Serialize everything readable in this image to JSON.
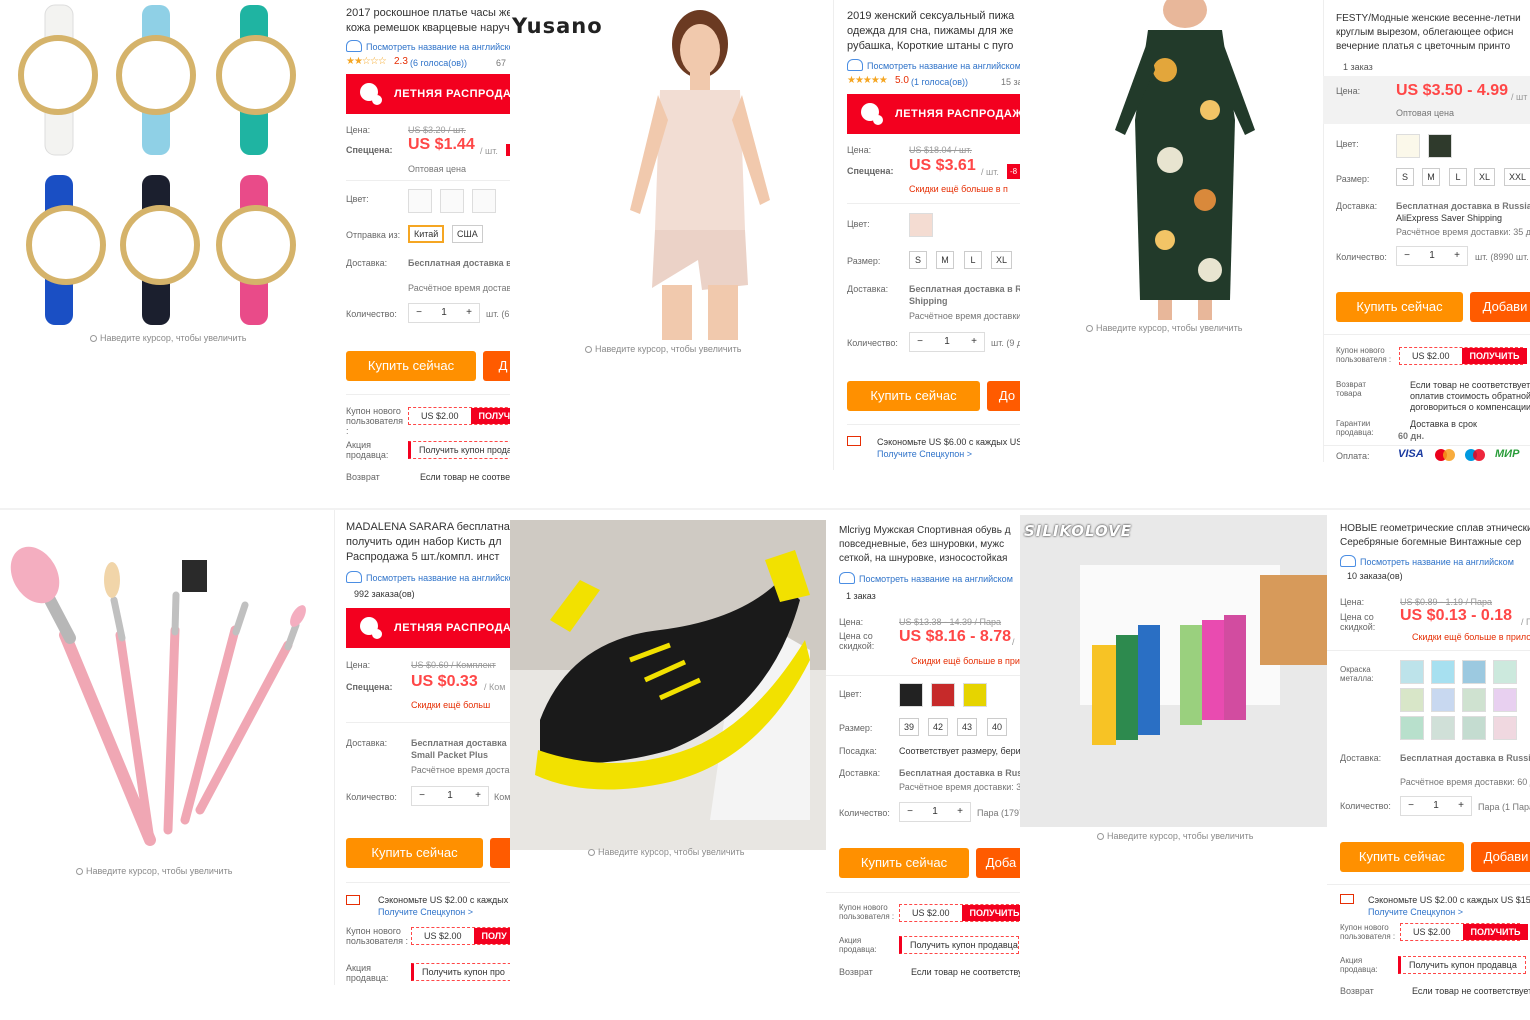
{
  "common": {
    "hover_hint": "Наведите курсор, чтобы увеличить",
    "price_label": "Цена:",
    "special_label": "Спеццена:",
    "price_disc_label": "Цена со скидкой:",
    "color_label": "Цвет:",
    "size_label": "Размер:",
    "delivery_label": "Доставка:",
    "quantity_label": "Количество:",
    "ship_from_label": "Отправка из:",
    "buy_now": "Купить сейчас",
    "add_cart_cut": "Д",
    "add_cart_full": "Добави",
    "add_cart_mid": "Доба",
    "coupon_label": "Купон нового пользователя :",
    "seller_promo_label": "Акция продавца:",
    "return_label": "Возврат",
    "return_goods_label": "Возврат товара",
    "guarantee_label": "Гарантии продавца:",
    "payment_label": "Оплата:",
    "summer_sale": "ЛЕТНЯЯ РАСПРОДАЖА",
    "translate_link": "Посмотреть название на английском",
    "wholesale": "Оптовая цена",
    "free_shipping_to": "Бесплатная доставка в",
    "estimated_time": "Расчётное время доставки:",
    "coupon_value": "US $2.00",
    "get": "ПОЛУЧИТЬ",
    "get_seller_coupon": "Получить купон продавца",
    "if_not_match": "Если товар не соответствует",
    "discount_more": "Скидки ещё больше в приложении",
    "get_special_coupon": "Получите Спецкупон >",
    "minus": "−",
    "plus": "+",
    "one": "1"
  },
  "products": [
    {
      "brand": "",
      "title_1": "2017 роскошное платье часы же",
      "title_2": "кожа ремешок кварцевые наруч",
      "rating": "2.3",
      "votes": "(6 голоса(ов))",
      "orders": "67",
      "stars": "★★☆☆☆",
      "old_price": "US $3.20 / шт.",
      "price": "US $1.44",
      "unit": "/ шт.",
      "ship_china": "Китай",
      "ship_usa": "США",
      "delivery": "Бесплатная доставка в",
      "unit_qty": "шт. (6",
      "return_text": "Если товар не соотве"
    },
    {
      "brand": "Yusano",
      "title_1": "2019 женский сексуальный пижа",
      "title_2": "одежда для сна, пижамы для же",
      "title_3": "рубашка, Короткие штаны с пуго",
      "rating": "5.0",
      "votes": "(1 голоса(ов))",
      "orders": "15 за",
      "stars": "★★★★★",
      "old_price": "US $18.04 / шт.",
      "price": "US $3.61",
      "unit": "/ шт.",
      "disc": "-8",
      "discount_app": "Скидки ещё больше в п",
      "sizes": [
        "S",
        "M",
        "L",
        "XL"
      ],
      "delivery_1": "Бесплатная доставка в R",
      "delivery_2": "Shipping",
      "unit_qty": "шт. (9 д",
      "buy_extra": "До",
      "save_text": "Сэкономьте US $6.00 с каждых US"
    },
    {
      "brand": "",
      "title_1": "FESTY/Модные женские весенне-летни",
      "title_2": "круглым вырезом, облегающее офисн",
      "title_3": "вечерние платья с цветочным принто",
      "orders": "1 заказ",
      "price": "US $3.50 - 4.99",
      "unit": "/ шт",
      "sizes": [
        "S",
        "M",
        "L",
        "XL",
        "XXL"
      ],
      "delivery_1": "Бесплатная доставка в Russian",
      "delivery_2": "AliExpress Saver Shipping",
      "est": "Расчётное время доставки: 35 д",
      "unit_qty": "шт. (8990 шт.",
      "return_text_1": "Если товар не соответствует с",
      "return_text_2": "оплатив стоимость обратной",
      "return_text_3": "договориться о компенсации",
      "guarantee_1": "Доставка в срок",
      "guarantee_2": "60 дн.",
      "pay_visa": "VISA",
      "pay_mir": "МИР"
    },
    {
      "brand": "",
      "title_1": "MADALENA SARARA бесплатная",
      "title_2": "получить один набор Кисть дл",
      "title_3": "Распродажа 5 шт./компл. инст",
      "orders": "992 заказа(ов)",
      "old_price": "US $0.60 / Комплект",
      "price": "US $0.33",
      "unit": "/ Ком",
      "discount_app": "Скидки ещё больш",
      "delivery_1": "Бесплатная доставка",
      "delivery_2": "Small Packet Plus",
      "est": "Расчётное время доста",
      "unit_qty": "Ком",
      "save_text": "Сэкономьте US $2.00 с каждых",
      "get_short": "ПОЛУ",
      "seller_short": "Получить купон про"
    },
    {
      "brand": "",
      "title_1": "Mlcriyg Мужская Спортивная обувь д",
      "title_2": "повседневные, без шнуровки, мужс",
      "title_3": "сеткой, на шнуровке, износостойкая",
      "orders": "1 заказ",
      "old_price": "US $13.38 - 14.39 / Пара",
      "price": "US $8.16 - 8.78",
      "unit": "/",
      "discount_app": "Скидки ещё больше в при",
      "sizes": [
        "39",
        "42",
        "43",
        "40"
      ],
      "fit_label": "Посадка:",
      "fit": "Соответствует размеру, бери",
      "delivery": "Бесплатная доставка в Russ",
      "est": "Расчётное время доставки: 3",
      "unit_qty": "Пара (1797",
      "return_text": "Если товар не соответству"
    },
    {
      "brand": "SILIKOLOVE",
      "title_1": "НОВЫЕ геометрические сплав этнически",
      "title_2": "Серебряные богемные Винтажные сер",
      "orders": "10 заказа(ов)",
      "old_price": "US $0.89 - 1.19 / Пара",
      "price": "US $0.13 - 0.18",
      "unit": "/ Пара",
      "discount_app": "Скидки ещё больше в прилож",
      "metal_label": "Окраска металла:",
      "delivery": "Бесплатная доставка в Russian",
      "est": "Расчётное время доставки: 60 д",
      "unit_qty": "Пара (1 Пара –",
      "save_text": "Сэкономьте US $2.00 с каждых US $15.00",
      "return_text": "Если товар не соответствует о"
    }
  ]
}
